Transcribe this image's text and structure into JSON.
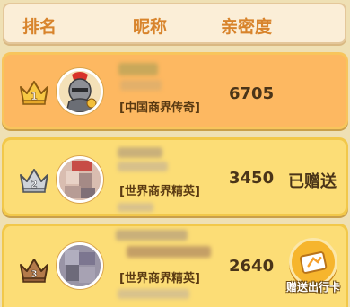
{
  "header": {
    "rank_label": "排名",
    "nickname_label": "昵称",
    "intimacy_label": "亲密度"
  },
  "rows": [
    {
      "rank": "1",
      "guild": "[中国商界传奇]",
      "score": "6705",
      "status": ""
    },
    {
      "rank": "2",
      "guild": "[世界商界精英]",
      "score": "3450",
      "status": "已赠送"
    },
    {
      "rank": "3",
      "guild": "[世界商界精英]",
      "score": "2640",
      "action_label": "赠送出行卡"
    }
  ],
  "icons": [
    "crown-gold-icon",
    "crown-silver-icon",
    "crown-bronze-icon",
    "send-card-icon"
  ],
  "colors": {
    "header_text": "#d8842c",
    "row1_bg": "#fdb861",
    "row_bg": "#fcdd76",
    "page_bg": "#efe0b4"
  }
}
